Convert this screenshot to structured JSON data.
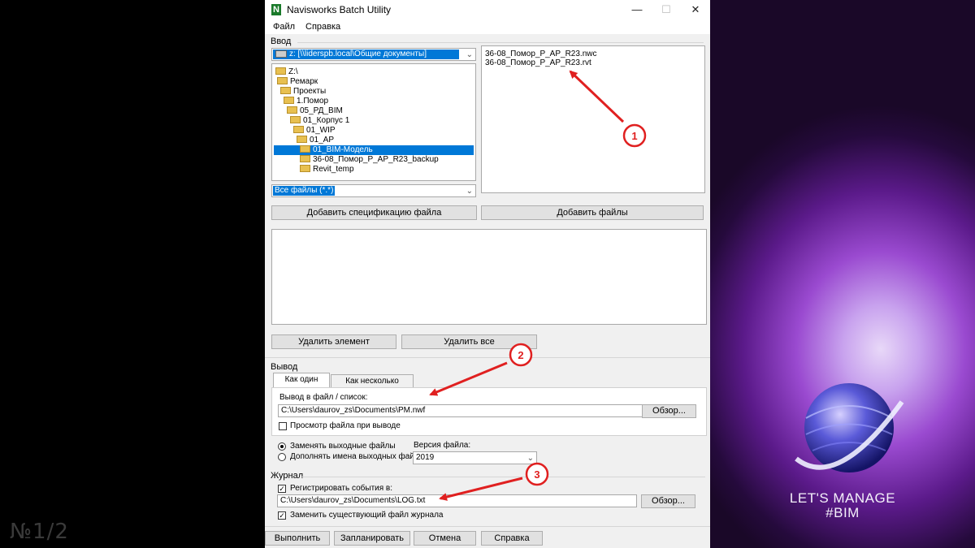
{
  "slide": {
    "counter": "№1/2",
    "brand_line1": "LET'S MANAGE",
    "brand_line2": "#BIM"
  },
  "window": {
    "title": "Navisworks Batch Utility",
    "app_icon_letter": "N"
  },
  "menu": [
    "Файл",
    "Справка"
  ],
  "input": {
    "group_label": "Ввод",
    "drive": "z: [\\\\liderspb.local\\Общие документы]",
    "tree": [
      "Z:\\",
      "Ремарк",
      "Проекты",
      "1.Помор",
      "05_РД_BIM",
      "01_Корпус 1",
      "01_WIP",
      "01_AP",
      "01_BIM-Модель",
      "36-08_Помор_P_AP_R23_backup",
      "Revit_temp"
    ],
    "selected_folder_index": 8,
    "filter": "Все файлы (*.*)",
    "files": [
      "36-08_Помор_P_AP_R23.nwc",
      "36-08_Помор_P_AP_R23.rvt"
    ],
    "add_spec_button": "Добавить спецификацию файла",
    "add_files_button": "Добавить файлы",
    "delete_item_button": "Удалить элемент",
    "delete_all_button": "Удалить все"
  },
  "output": {
    "group_label": "Вывод",
    "tabs": [
      "Как один файл",
      "Как несколько файлов"
    ],
    "active_tab": 0,
    "path_label": "Вывод в файл / список:",
    "path": "C:\\Users\\daurov_zs\\Documents\\PM.nwf",
    "browse_button": "Обзор...",
    "view_checkbox": "Просмотр файла при выводе",
    "view_checked": false,
    "replace_radio": "Заменять выходные файлы",
    "append_radio": "Дополнять имена выходных файлов",
    "replace_selected": true,
    "version_label": "Версия файла:",
    "version": "2019"
  },
  "log": {
    "group_label": "Журнал",
    "register_checkbox": "Регистрировать события в:",
    "register_checked": true,
    "path": "C:\\Users\\daurov_zs\\Documents\\LOG.txt",
    "browse_button": "Обзор...",
    "overwrite_checkbox": "Заменить существующий файл журнала",
    "overwrite_checked": true
  },
  "footer": [
    "Выполнить",
    "Запланировать",
    "Отмена",
    "Справка"
  ],
  "annotations": [
    "1",
    "2",
    "3"
  ],
  "colors": {
    "annotation_red": "#e02020",
    "selection_blue": "#0078d7",
    "folder_yellow": "#e8c050"
  }
}
